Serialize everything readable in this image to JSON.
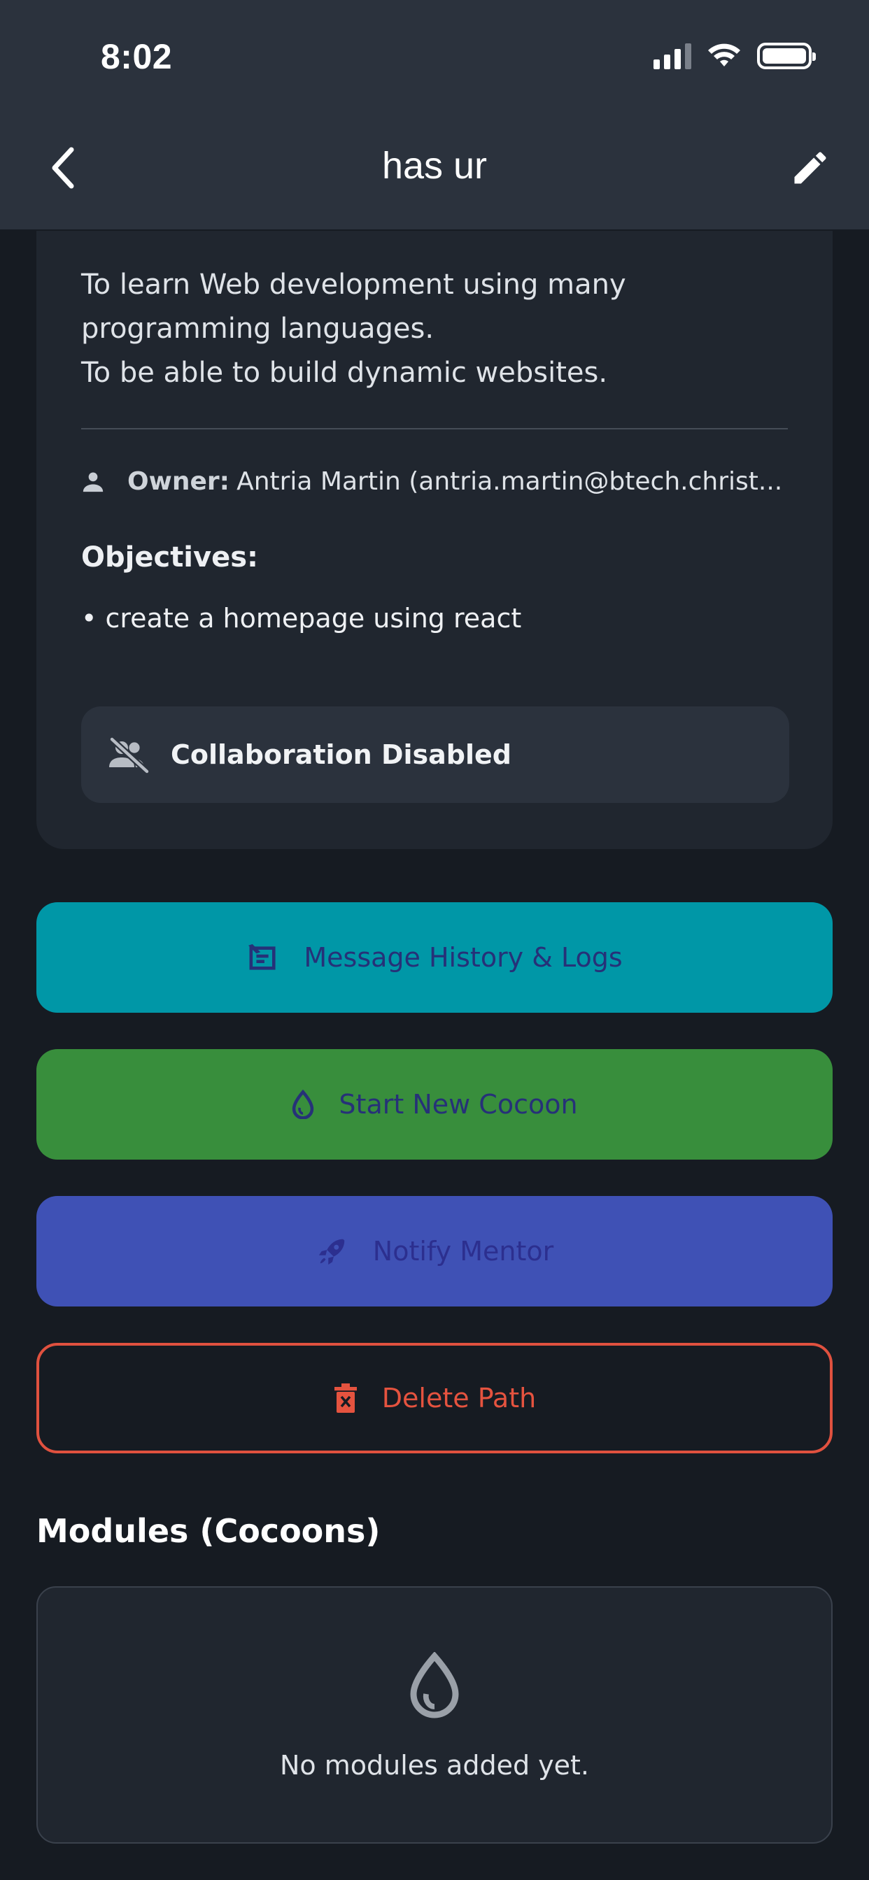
{
  "status_bar": {
    "time": "8:02"
  },
  "header": {
    "title": "has ur",
    "back_icon": "chevron-left-icon",
    "edit_icon": "pencil-icon"
  },
  "path_card": {
    "description": "To learn Web development using many\nprogramming languages.\nTo be able to build dynamic websites.",
    "owner_label": "Owner:",
    "owner_value": "Antria Martin (antria.martin@btech.christ...",
    "objectives_title": "Objectives:",
    "objectives": [
      "• create a homepage using react"
    ],
    "collaboration_status": "Collaboration Disabled"
  },
  "actions": {
    "message_history": "Message History & Logs",
    "start_cocoon": "Start New Cocoon",
    "notify_mentor": "Notify Mentor",
    "delete_path": "Delete Path"
  },
  "modules": {
    "title": "Modules (Cocoons)",
    "empty_text": "No modules added yet."
  },
  "colors": {
    "background": "#161b22",
    "header": "#2b323d",
    "card": "#20262f",
    "message_button": "#0097a7",
    "cocoon_button": "#388e3c",
    "notify_button": "#3f51b5",
    "delete_outline": "#e0513f"
  }
}
